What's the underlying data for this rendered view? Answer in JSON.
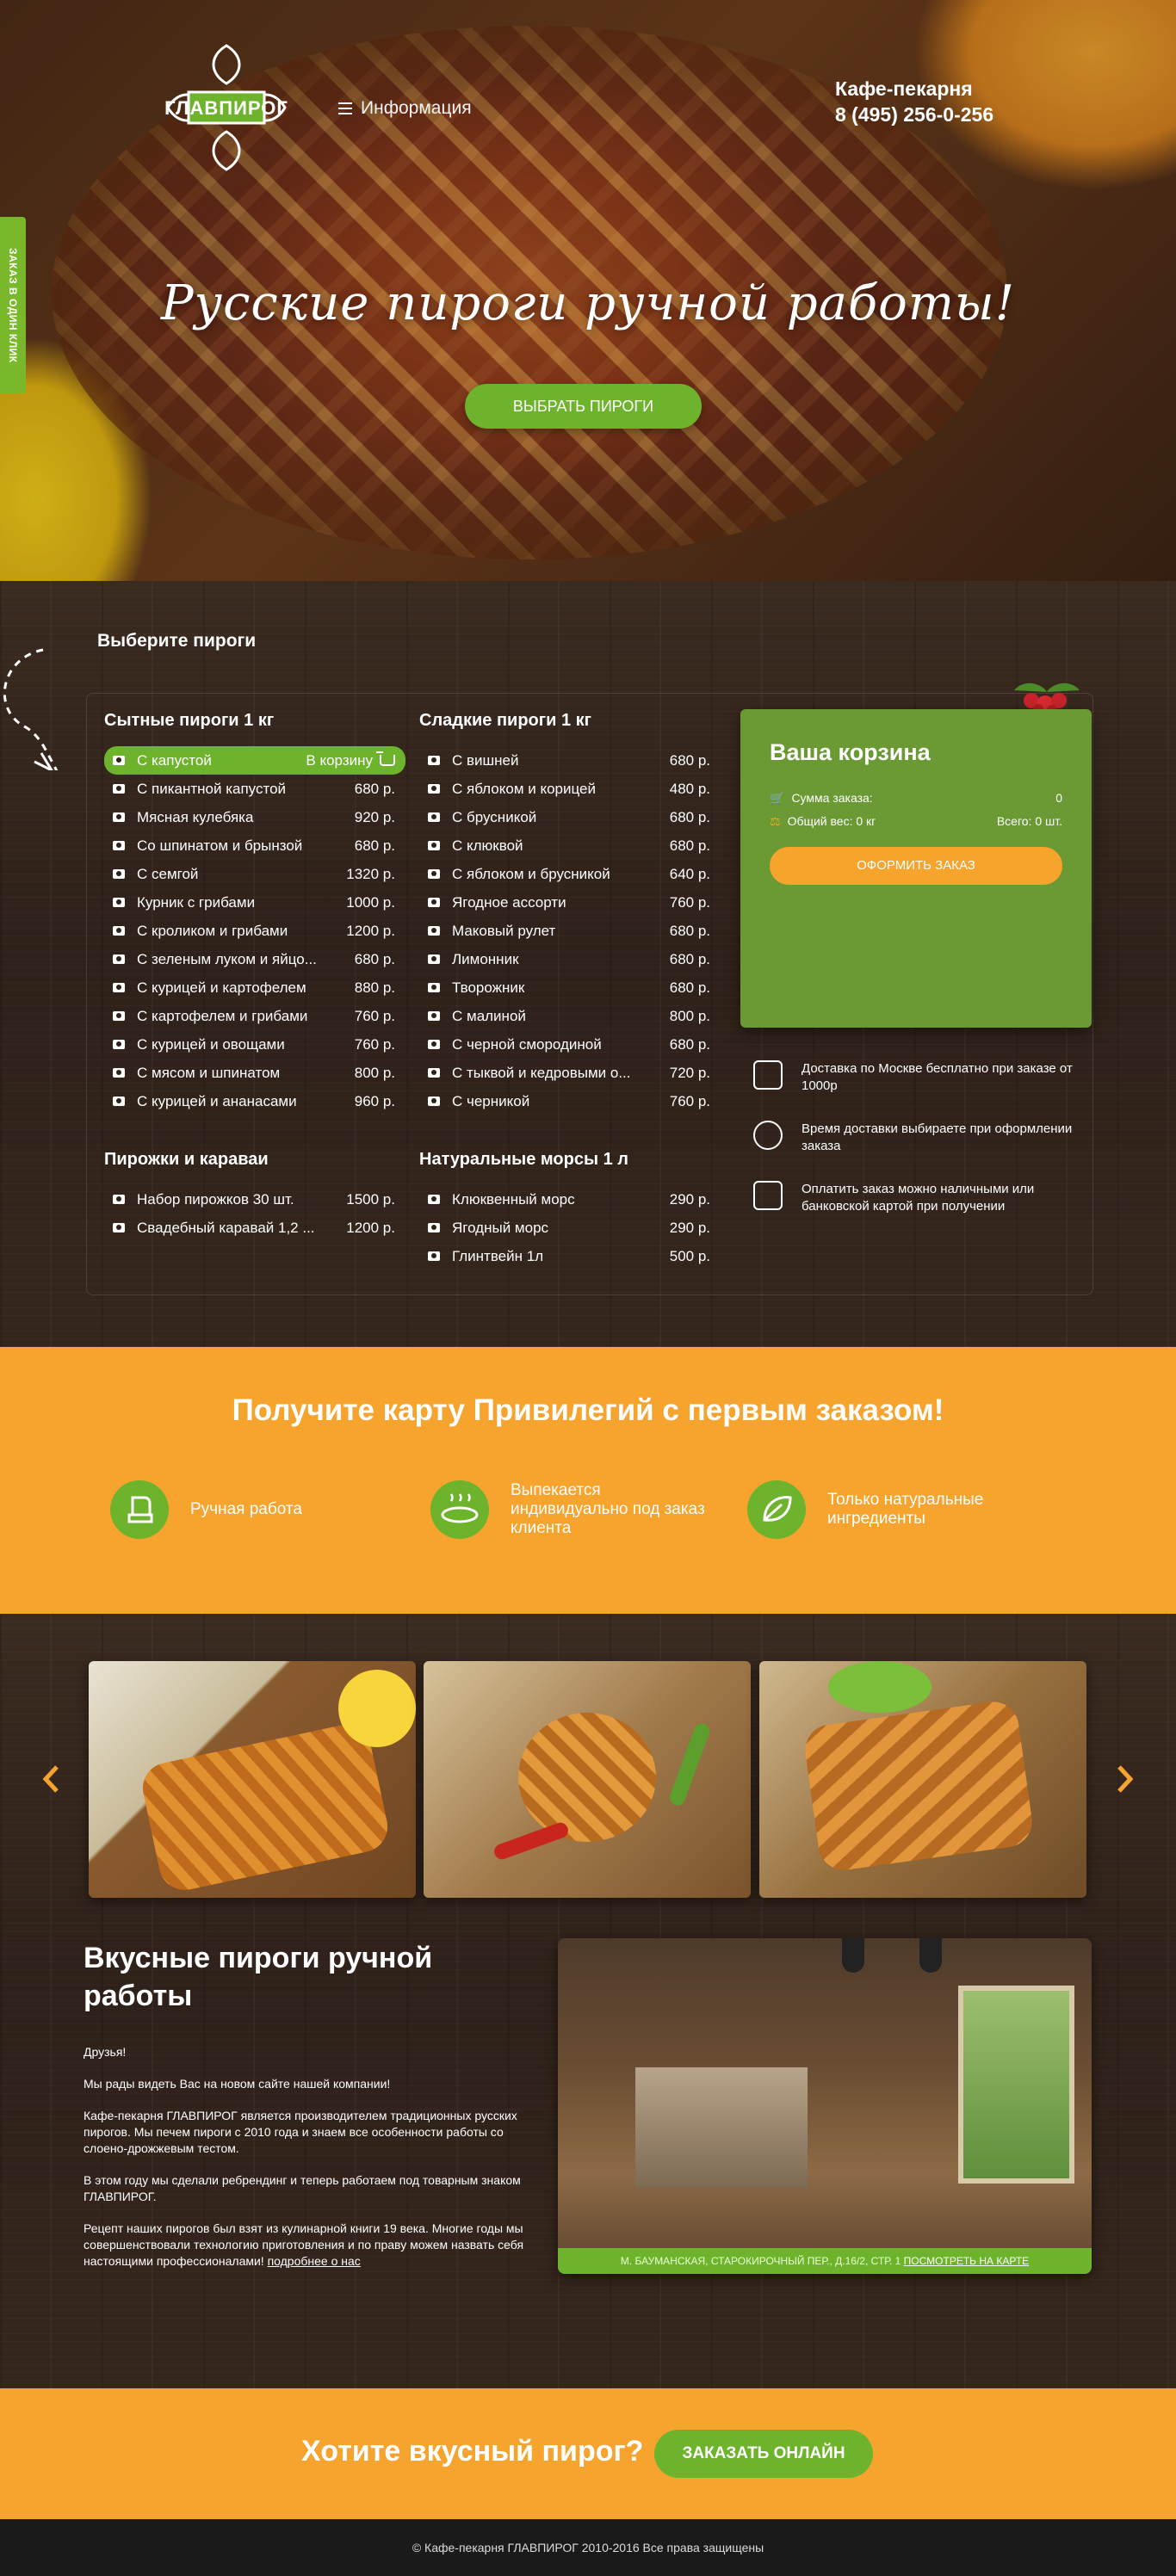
{
  "side_tab": "ЗАКАЗ В ОДИН КЛИК",
  "header": {
    "logo_text": "ГЛАВПИРОГ",
    "menu_label": "Информация",
    "contact_title": "Кафе-пекарня",
    "contact_phone": "8 (495) 256-0-256"
  },
  "hero": {
    "title": "Русские пироги ручной работы!",
    "button": "ВЫБРАТЬ ПИРОГИ"
  },
  "menu": {
    "title": "Выберите пироги",
    "add_to_cart": "В корзину",
    "columns": [
      {
        "heading": "Сытные пироги 1 кг",
        "items": [
          {
            "name": "С капустой",
            "price": ""
          },
          {
            "name": "С пикантной капустой",
            "price": "680 р."
          },
          {
            "name": "Мясная кулебяка",
            "price": "920 р."
          },
          {
            "name": "Со шпинатом и брынзой",
            "price": "680 р."
          },
          {
            "name": "С семгой",
            "price": "1320 р."
          },
          {
            "name": "Курник с грибами",
            "price": "1000 р."
          },
          {
            "name": "С кроликом и грибами",
            "price": "1200 р."
          },
          {
            "name": "С зеленым луком и яйцо...",
            "price": "680 р."
          },
          {
            "name": "С курицей и картофелем",
            "price": "880 р."
          },
          {
            "name": "С картофелем и грибами",
            "price": "760 р."
          },
          {
            "name": "С курицей и овощами",
            "price": "760 р."
          },
          {
            "name": "С мясом и шпинатом",
            "price": "800 р."
          },
          {
            "name": "С курицей и ананасами",
            "price": "960 р."
          }
        ]
      },
      {
        "heading": "Сладкие пироги 1 кг",
        "items": [
          {
            "name": "С вишней",
            "price": "680 р."
          },
          {
            "name": "С яблоком и корицей",
            "price": "480 р."
          },
          {
            "name": "С брусникой",
            "price": "680 р."
          },
          {
            "name": "С клюквой",
            "price": "680 р."
          },
          {
            "name": "С яблоком и брусникой",
            "price": "640 р."
          },
          {
            "name": "Ягодное ассорти",
            "price": "760 р."
          },
          {
            "name": "Маковый рулет",
            "price": "680 р."
          },
          {
            "name": "Лимонник",
            "price": "680 р."
          },
          {
            "name": "Творожник",
            "price": "680 р."
          },
          {
            "name": "С малиной",
            "price": "800 р."
          },
          {
            "name": "С черной смородиной",
            "price": "680 р."
          },
          {
            "name": "С тыквой и кедровыми о...",
            "price": "720 р."
          },
          {
            "name": "С черникой",
            "price": "760 р."
          }
        ]
      },
      {
        "heading": "Пирожки и караваи",
        "items": [
          {
            "name": "Набор пирожков 30 шт.",
            "price": "1500 р."
          },
          {
            "name": "Свадебный каравай 1,2 ...",
            "price": "1200 р."
          }
        ]
      },
      {
        "heading": "Натуральные морсы 1 л",
        "items": [
          {
            "name": "Клюквенный морс",
            "price": "290 р."
          },
          {
            "name": "Ягодный морс",
            "price": "290 р."
          },
          {
            "name": "Глинтвейн 1л",
            "price": "500 р."
          }
        ]
      }
    ]
  },
  "cart": {
    "title": "Ваша корзина",
    "sum_label": "Сумма заказа:",
    "sum_value": "0",
    "weight_label": "Общий вес: 0 кг",
    "total_label": "Всего: 0 шт.",
    "checkout": "ОФОРМИТЬ ЗАКАЗ"
  },
  "info": [
    {
      "icon": "delivery-car-icon",
      "text": "Доставка по Москве бесплатно при заказе от 1000р"
    },
    {
      "icon": "clock-icon",
      "text": "Время доставки выбираете при оформлении заказа"
    },
    {
      "icon": "wallet-icon",
      "text": "Оплатить заказ можно наличными или банковской картой при получении"
    }
  ],
  "promo": {
    "title": "Получите карту Привилегий с первым заказом!",
    "features": [
      {
        "icon": "oven-mitt-icon",
        "text": "Ручная работа"
      },
      {
        "icon": "pie-dish-icon",
        "text": "Выпекается индивидуально под заказ клиента"
      },
      {
        "icon": "leaf-icon",
        "text": "Только натуральные ингредиенты"
      }
    ]
  },
  "about": {
    "title": "Вкусные пироги ручной работы",
    "paragraphs": [
      "Друзья!",
      "Мы рады видеть Вас на новом сайте нашей компании!",
      "Кафе-пекарня ГЛАВПИРОГ является производителем традиционных русских пирогов. Мы печем пироги с 2010 года и знаем все особенности работы со слоено-дрожжевым тестом.",
      "В этом году мы сделали ребрендинг и теперь работаем под товарным знаком ГЛАВПИРОГ.",
      "Рецепт наших пирогов был взят из кулинарной книги 19 века. Многие годы мы совершенствовали технологию приготовления и по праву можем назвать себя настоящими профессионалами!"
    ],
    "more_link": "подробнее о нас",
    "address": "М. БАУМАНСКАЯ, СТАРОКИРОЧНЫЙ ПЕР., Д.16/2, СТР. 1",
    "map_link": "ПОСМОТРЕТЬ НА КАРТЕ"
  },
  "cta": {
    "title": "Хотите вкусный пирог?",
    "button": "ЗАКАЗАТЬ ОНЛАЙН"
  },
  "footer": "© Кафе-пекарня ГЛАВПИРОГ 2010-2016 Все права защищены",
  "colors": {
    "green": "#6db32c",
    "orange": "#f7a42f",
    "cart_green": "#6b9a34"
  }
}
